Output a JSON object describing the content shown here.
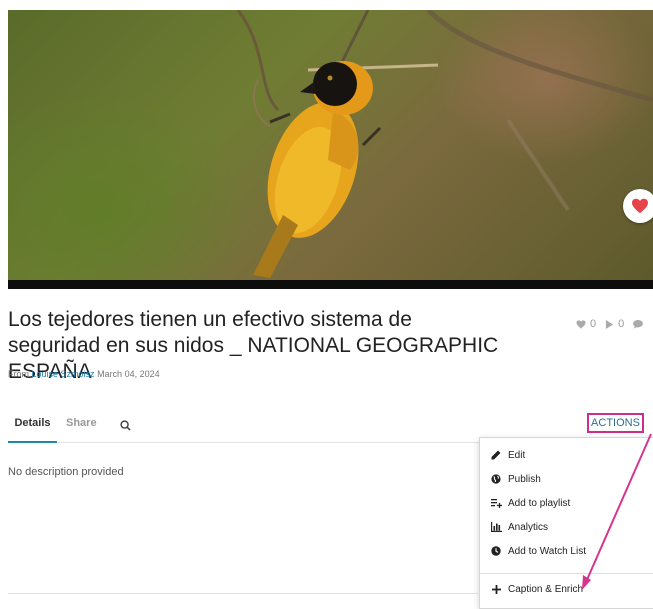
{
  "video": {
    "favorite_icon": "heart-icon",
    "favorite_color": "#e8424a"
  },
  "title": "Los tejedores tienen un efectivo sistema de seguridad en sus nidos _ NATIONAL GEOGRAPHIC ESPAÑA",
  "stats": {
    "likes": "0",
    "plays": "0",
    "comment_icon": "comment-icon"
  },
  "byline": {
    "from": "From",
    "author": "Louise Szmoisz",
    "date": "March 04, 2024"
  },
  "tabs": [
    {
      "label": "Details",
      "active": true
    },
    {
      "label": "Share",
      "active": false
    }
  ],
  "actions_label": "ACTIONS",
  "description": "No description provided",
  "menu": {
    "items": [
      {
        "label": "Edit",
        "icon": "pencil-icon"
      },
      {
        "label": "Publish",
        "icon": "globe-icon"
      },
      {
        "label": "Add to playlist",
        "icon": "playlist-add-icon"
      },
      {
        "label": "Analytics",
        "icon": "bar-chart-icon"
      },
      {
        "label": "Add to Watch List",
        "icon": "clock-icon"
      }
    ],
    "caption_item": {
      "label": "Caption & Enrich",
      "icon": "plus-icon"
    }
  },
  "colors": {
    "accent": "#1f87a8",
    "highlight": "#cc2f8a",
    "link": "#1f7fa8"
  }
}
